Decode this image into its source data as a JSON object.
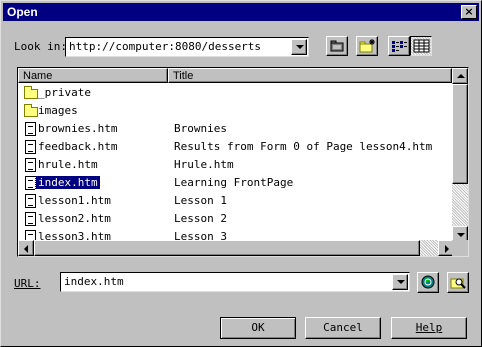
{
  "window": {
    "title": "Open",
    "close_glyph": "×"
  },
  "look_in": {
    "label": "Look in:",
    "value": "http://computer:8080/desserts"
  },
  "toolbar": {
    "icons": [
      "up-one-level-icon",
      "create-new-folder-icon",
      "list-view-icon",
      "details-view-icon"
    ]
  },
  "file_list": {
    "columns": [
      "Name",
      "Title"
    ],
    "rows": [
      {
        "name": "_private",
        "title": "",
        "type": "folder"
      },
      {
        "name": "images",
        "title": "",
        "type": "folder"
      },
      {
        "name": "brownies.htm",
        "title": "Brownies",
        "type": "file"
      },
      {
        "name": "feedback.htm",
        "title": "Results from Form 0 of Page lesson4.htm",
        "type": "file"
      },
      {
        "name": "hrule.htm",
        "title": "Hrule.htm",
        "type": "file"
      },
      {
        "name": "index.htm",
        "title": "Learning FrontPage",
        "type": "file",
        "selected": true
      },
      {
        "name": "lesson1.htm",
        "title": "Lesson 1",
        "type": "file"
      },
      {
        "name": "lesson2.htm",
        "title": "Lesson 2",
        "type": "file"
      },
      {
        "name": "lesson3.htm",
        "title": "Lesson 3",
        "type": "file"
      }
    ]
  },
  "url_field": {
    "label": "URL:",
    "value": "index.htm"
  },
  "buttons": {
    "ok": "OK",
    "cancel": "Cancel",
    "help": "Help"
  },
  "colors": {
    "titlebar": "#000080",
    "face": "#c0c0c0",
    "selection": "#000080"
  }
}
